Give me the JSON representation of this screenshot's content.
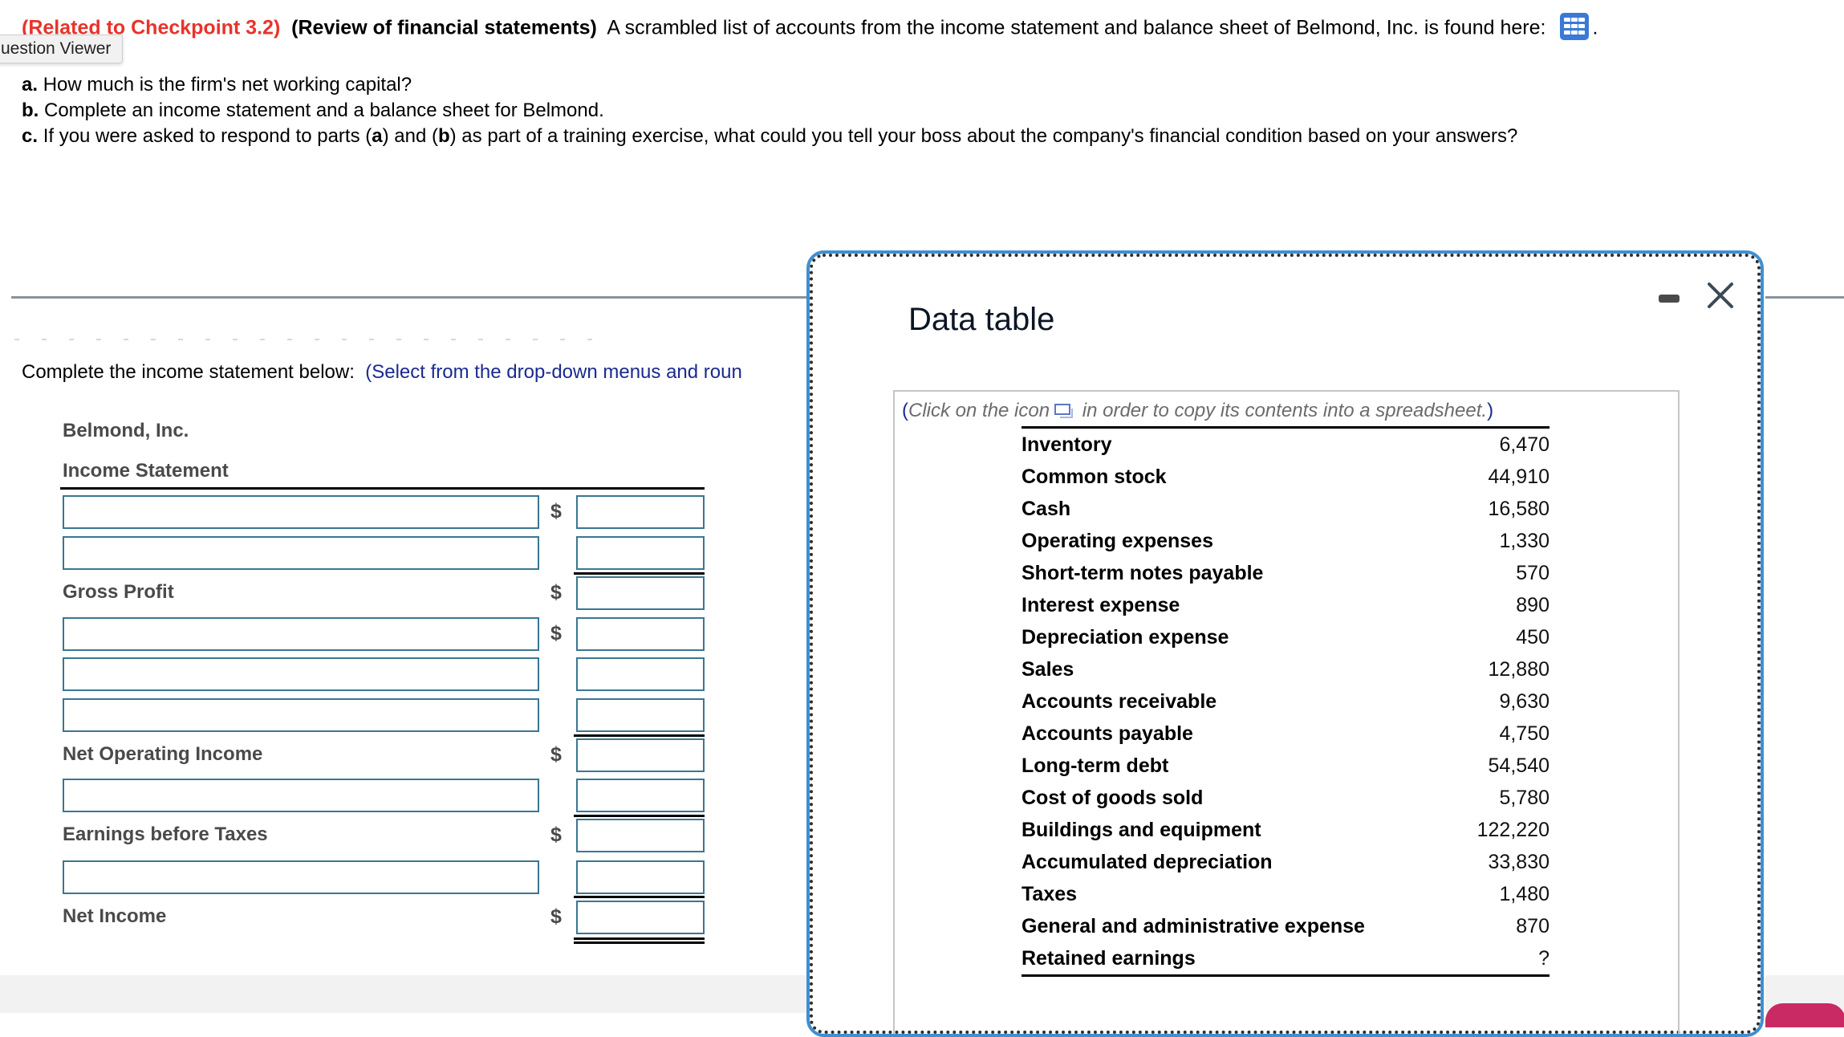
{
  "question": {
    "related": "(Related to Checkpoint 3.2)",
    "topic": "(Review of financial statements)",
    "intro": "A scrambled list of accounts from the income statement and balance sheet of Belmond, Inc. is found here:",
    "trailing": ".",
    "data_icon": "grid-table-icon",
    "parts": [
      {
        "letter": "a.",
        "text": "How much is the firm's net working capital?"
      },
      {
        "letter": "b.",
        "text": "Complete an income statement and a balance sheet for Belmond."
      },
      {
        "letter": "c.",
        "pre": "If you were asked to respond to parts (",
        "a": "a",
        "mid": ") and (",
        "b": "b",
        "post": ") as part of a training exercise, what could you tell your boss about the company's financial condition based on your answers?"
      }
    ]
  },
  "tooltip": "uestion Viewer",
  "instructions": {
    "lead": "Complete the income statement below:",
    "hint": "(Select from the drop-down menus and roun"
  },
  "income_statement": {
    "company": "Belmond, Inc.",
    "title": "Income Statement",
    "currency_symbol": "$",
    "rows": [
      {
        "type": "input",
        "dollar": true,
        "label_value": "",
        "amount_value": ""
      },
      {
        "type": "input",
        "dollar": false,
        "label_value": "",
        "amount_value": ""
      },
      {
        "type": "subtotal",
        "label": "Gross Profit",
        "dollar": true,
        "amount_value": ""
      },
      {
        "type": "input",
        "dollar": true,
        "label_value": "",
        "amount_value": ""
      },
      {
        "type": "input",
        "dollar": false,
        "label_value": "",
        "amount_value": ""
      },
      {
        "type": "input",
        "dollar": false,
        "label_value": "",
        "amount_value": ""
      },
      {
        "type": "subtotal",
        "label": "Net Operating Income",
        "dollar": true,
        "amount_value": ""
      },
      {
        "type": "input",
        "dollar": false,
        "label_value": "",
        "amount_value": ""
      },
      {
        "type": "subtotal",
        "label": "Earnings before Taxes",
        "dollar": true,
        "amount_value": ""
      },
      {
        "type": "input",
        "dollar": false,
        "label_value": "",
        "amount_value": ""
      },
      {
        "type": "total",
        "label": "Net Income",
        "dollar": true,
        "amount_value": ""
      }
    ]
  },
  "modal": {
    "title": "Data table",
    "minimize_icon": "minimize-icon",
    "close_icon": "close-icon",
    "note_open": "(",
    "note_pre": "Click on the icon",
    "note_post": "in order to copy its contents into a spreadsheet.",
    "note_close": ")",
    "accounts": [
      {
        "name": "Inventory",
        "value": "6,470"
      },
      {
        "name": "Common stock",
        "value": "44,910"
      },
      {
        "name": "Cash",
        "value": "16,580"
      },
      {
        "name": "Operating expenses",
        "value": "1,330"
      },
      {
        "name": "Short-term notes payable",
        "value": "570"
      },
      {
        "name": "Interest expense",
        "value": "890"
      },
      {
        "name": "Depreciation expense",
        "value": "450"
      },
      {
        "name": "Sales",
        "value": "12,880"
      },
      {
        "name": "Accounts receivable",
        "value": "9,630"
      },
      {
        "name": "Accounts payable",
        "value": "4,750"
      },
      {
        "name": "Long-term debt",
        "value": "54,540"
      },
      {
        "name": "Cost of goods sold",
        "value": "5,780"
      },
      {
        "name": "Buildings and equipment",
        "value": "122,220"
      },
      {
        "name": "Accumulated depreciation",
        "value": "33,830"
      },
      {
        "name": "Taxes",
        "value": "1,480"
      },
      {
        "name": "General and administrative expense",
        "value": "870"
      },
      {
        "name": "Retained earnings",
        "value": "?"
      }
    ]
  },
  "colors": {
    "related_red": "#e8332b",
    "hint_blue": "#1a2a8f",
    "input_border": "#3a7692",
    "modal_border": "#3f8fd2",
    "icon_blue": "#3a7ad6"
  }
}
